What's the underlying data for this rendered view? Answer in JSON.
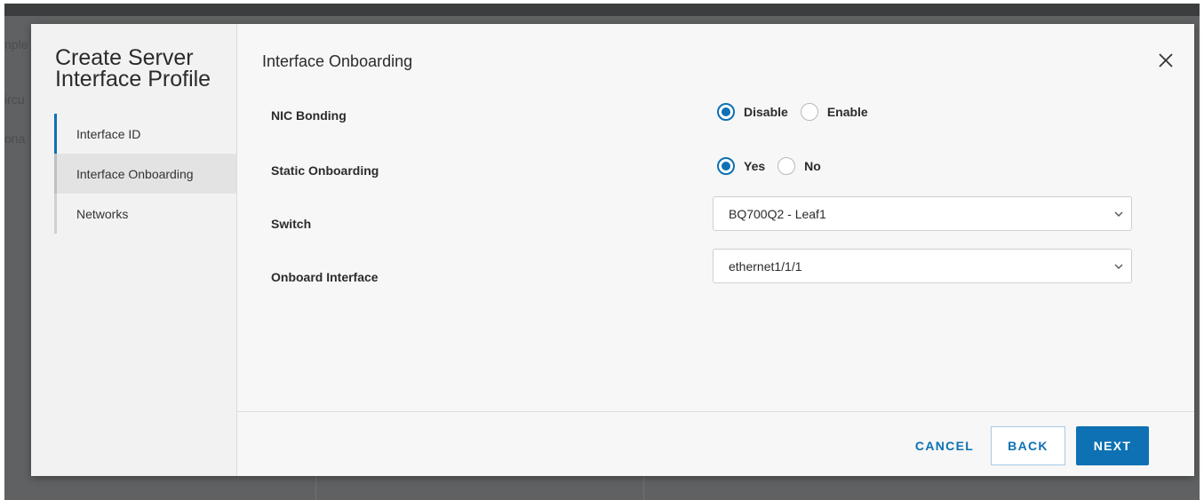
{
  "backdrop": {
    "ghost_lines": [
      "nple",
      "ircu",
      "ona"
    ]
  },
  "modal": {
    "title": "Create Server Interface Profile",
    "steps": [
      {
        "label": "Interface ID"
      },
      {
        "label": "Interface Onboarding"
      },
      {
        "label": "Networks"
      }
    ],
    "heading": "Interface Onboarding",
    "close_icon": "close-icon",
    "fields": {
      "nic_bonding": {
        "label": "NIC Bonding",
        "options": [
          "Disable",
          "Enable"
        ],
        "selected": "Disable"
      },
      "static_onboarding": {
        "label": "Static Onboarding",
        "options": [
          "Yes",
          "No"
        ],
        "selected": "Yes"
      },
      "switch": {
        "label": "Switch",
        "value": "BQ700Q2 - Leaf1"
      },
      "onboard_interface": {
        "label": "Onboard Interface",
        "value": "ethernet1/1/1"
      }
    },
    "footer": {
      "cancel": "CANCEL",
      "back": "BACK",
      "next": "NEXT"
    },
    "colors": {
      "accent": "#0d71b3"
    }
  }
}
